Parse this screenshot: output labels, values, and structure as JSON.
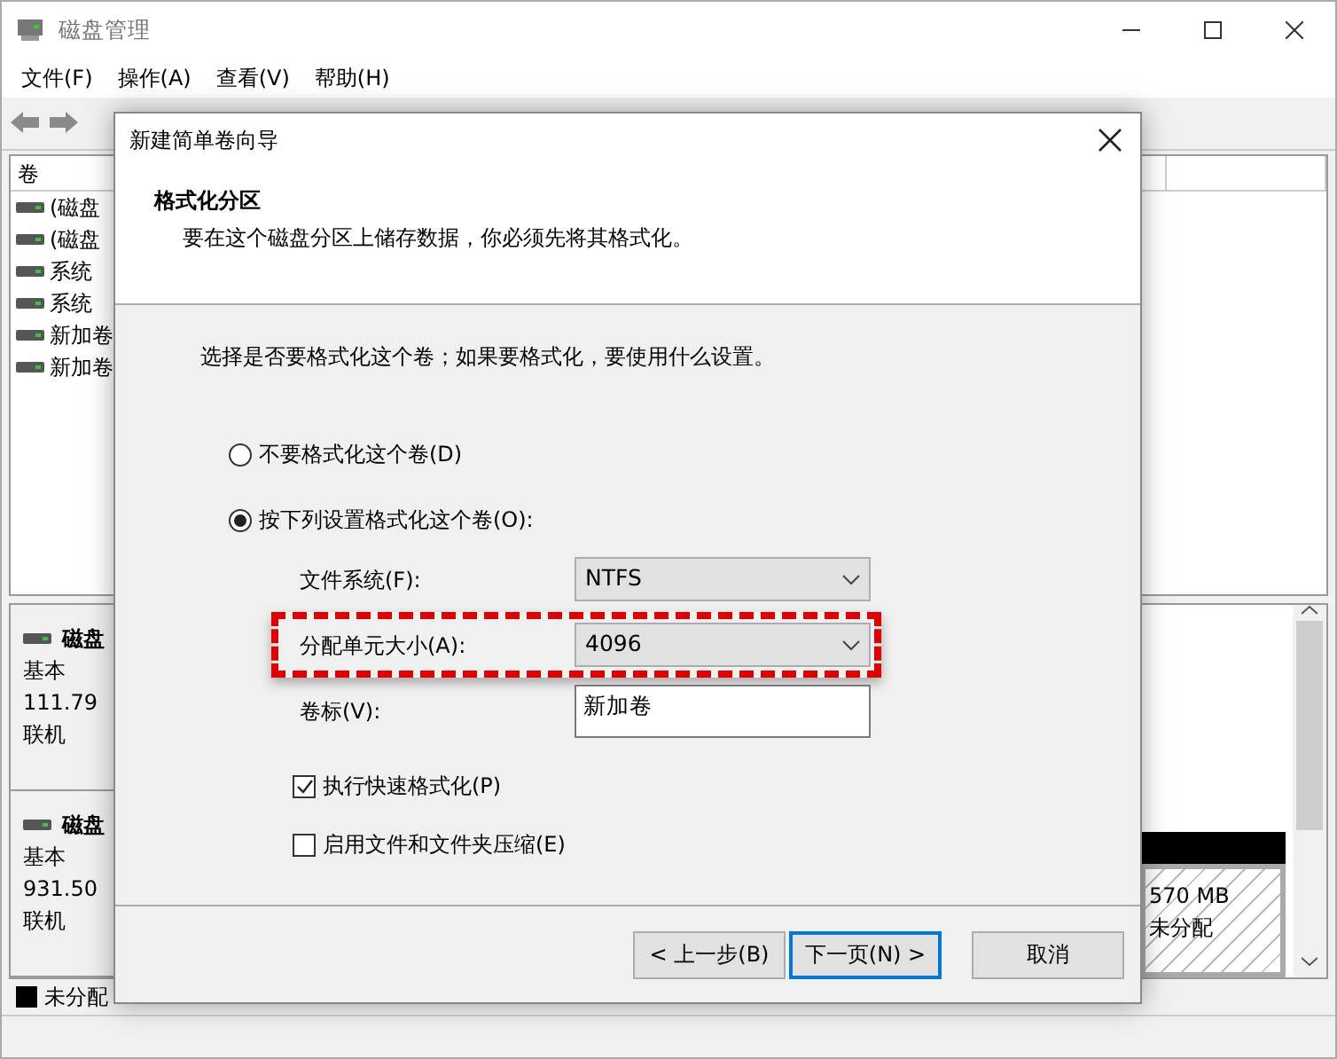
{
  "window": {
    "title": "磁盘管理"
  },
  "menu": [
    {
      "label": "文件(F)"
    },
    {
      "label": "操作(A)"
    },
    {
      "label": "查看(V)"
    },
    {
      "label": "帮助(H)"
    }
  ],
  "volume_list": {
    "header": "卷",
    "rows": [
      "(磁盘",
      "(磁盘",
      "系统",
      "系统",
      "新加卷",
      "新加卷"
    ]
  },
  "disks": [
    {
      "name": "磁盘",
      "type": "基本",
      "size": "111.79",
      "status": "联机"
    },
    {
      "name": "磁盘",
      "type": "基本",
      "size": "931.50",
      "status": "联机",
      "partitions": [
        {
          "size": "570 MB",
          "label": "未分配",
          "kind": "unallocated"
        }
      ]
    }
  ],
  "legend": [
    {
      "label": "未分配",
      "color": "#000000"
    }
  ],
  "dialog": {
    "title": "新建简单卷向导",
    "heading": "格式化分区",
    "subheading": "要在这个磁盘分区上储存数据，你必须先将其格式化。",
    "instruction": "选择是否要格式化这个卷；如果要格式化，要使用什么设置。",
    "options": [
      {
        "label": "不要格式化这个卷(D)",
        "selected": false
      },
      {
        "label": "按下列设置格式化这个卷(O):",
        "selected": true
      }
    ],
    "fields": [
      {
        "label": "文件系统(F):",
        "kind": "select",
        "value": "NTFS",
        "highlighted": false
      },
      {
        "label": "分配单元大小(A):",
        "kind": "select",
        "value": "4096",
        "highlighted": true
      },
      {
        "label": "卷标(V):",
        "kind": "text",
        "value": "新加卷",
        "highlighted": false
      }
    ],
    "checkboxes": [
      {
        "label": "执行快速格式化(P)",
        "checked": true
      },
      {
        "label": "启用文件和文件夹压缩(E)",
        "checked": false
      }
    ],
    "buttons": [
      {
        "label": "< 上一步(B)",
        "default": false
      },
      {
        "label": "下一页(N) >",
        "default": true
      },
      {
        "label": "取消",
        "default": false
      }
    ]
  }
}
